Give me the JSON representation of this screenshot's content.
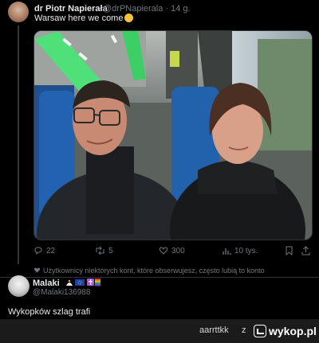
{
  "tweet": {
    "author_name": "dr Piotr Napierała",
    "author_handle_time": "@drPNapierala · 14 g.",
    "text": "Warsaw here we come",
    "emoji": "smiling-face-icon",
    "photo_description": "selfie-photo",
    "actions": {
      "replies": "22",
      "retweets": "5",
      "likes": "300",
      "views": "10 tys."
    },
    "liked_by_text": "Użytkownicy niektórych kont, które obserwujesz, często lubią to konto"
  },
  "reply": {
    "author_name": "Malaki",
    "author_handle": "@Malaki136988",
    "text": "Wykopków szlag trafi"
  },
  "footer": {
    "author": "aarrttkk",
    "via": "z",
    "brand": "wykop.pl"
  }
}
